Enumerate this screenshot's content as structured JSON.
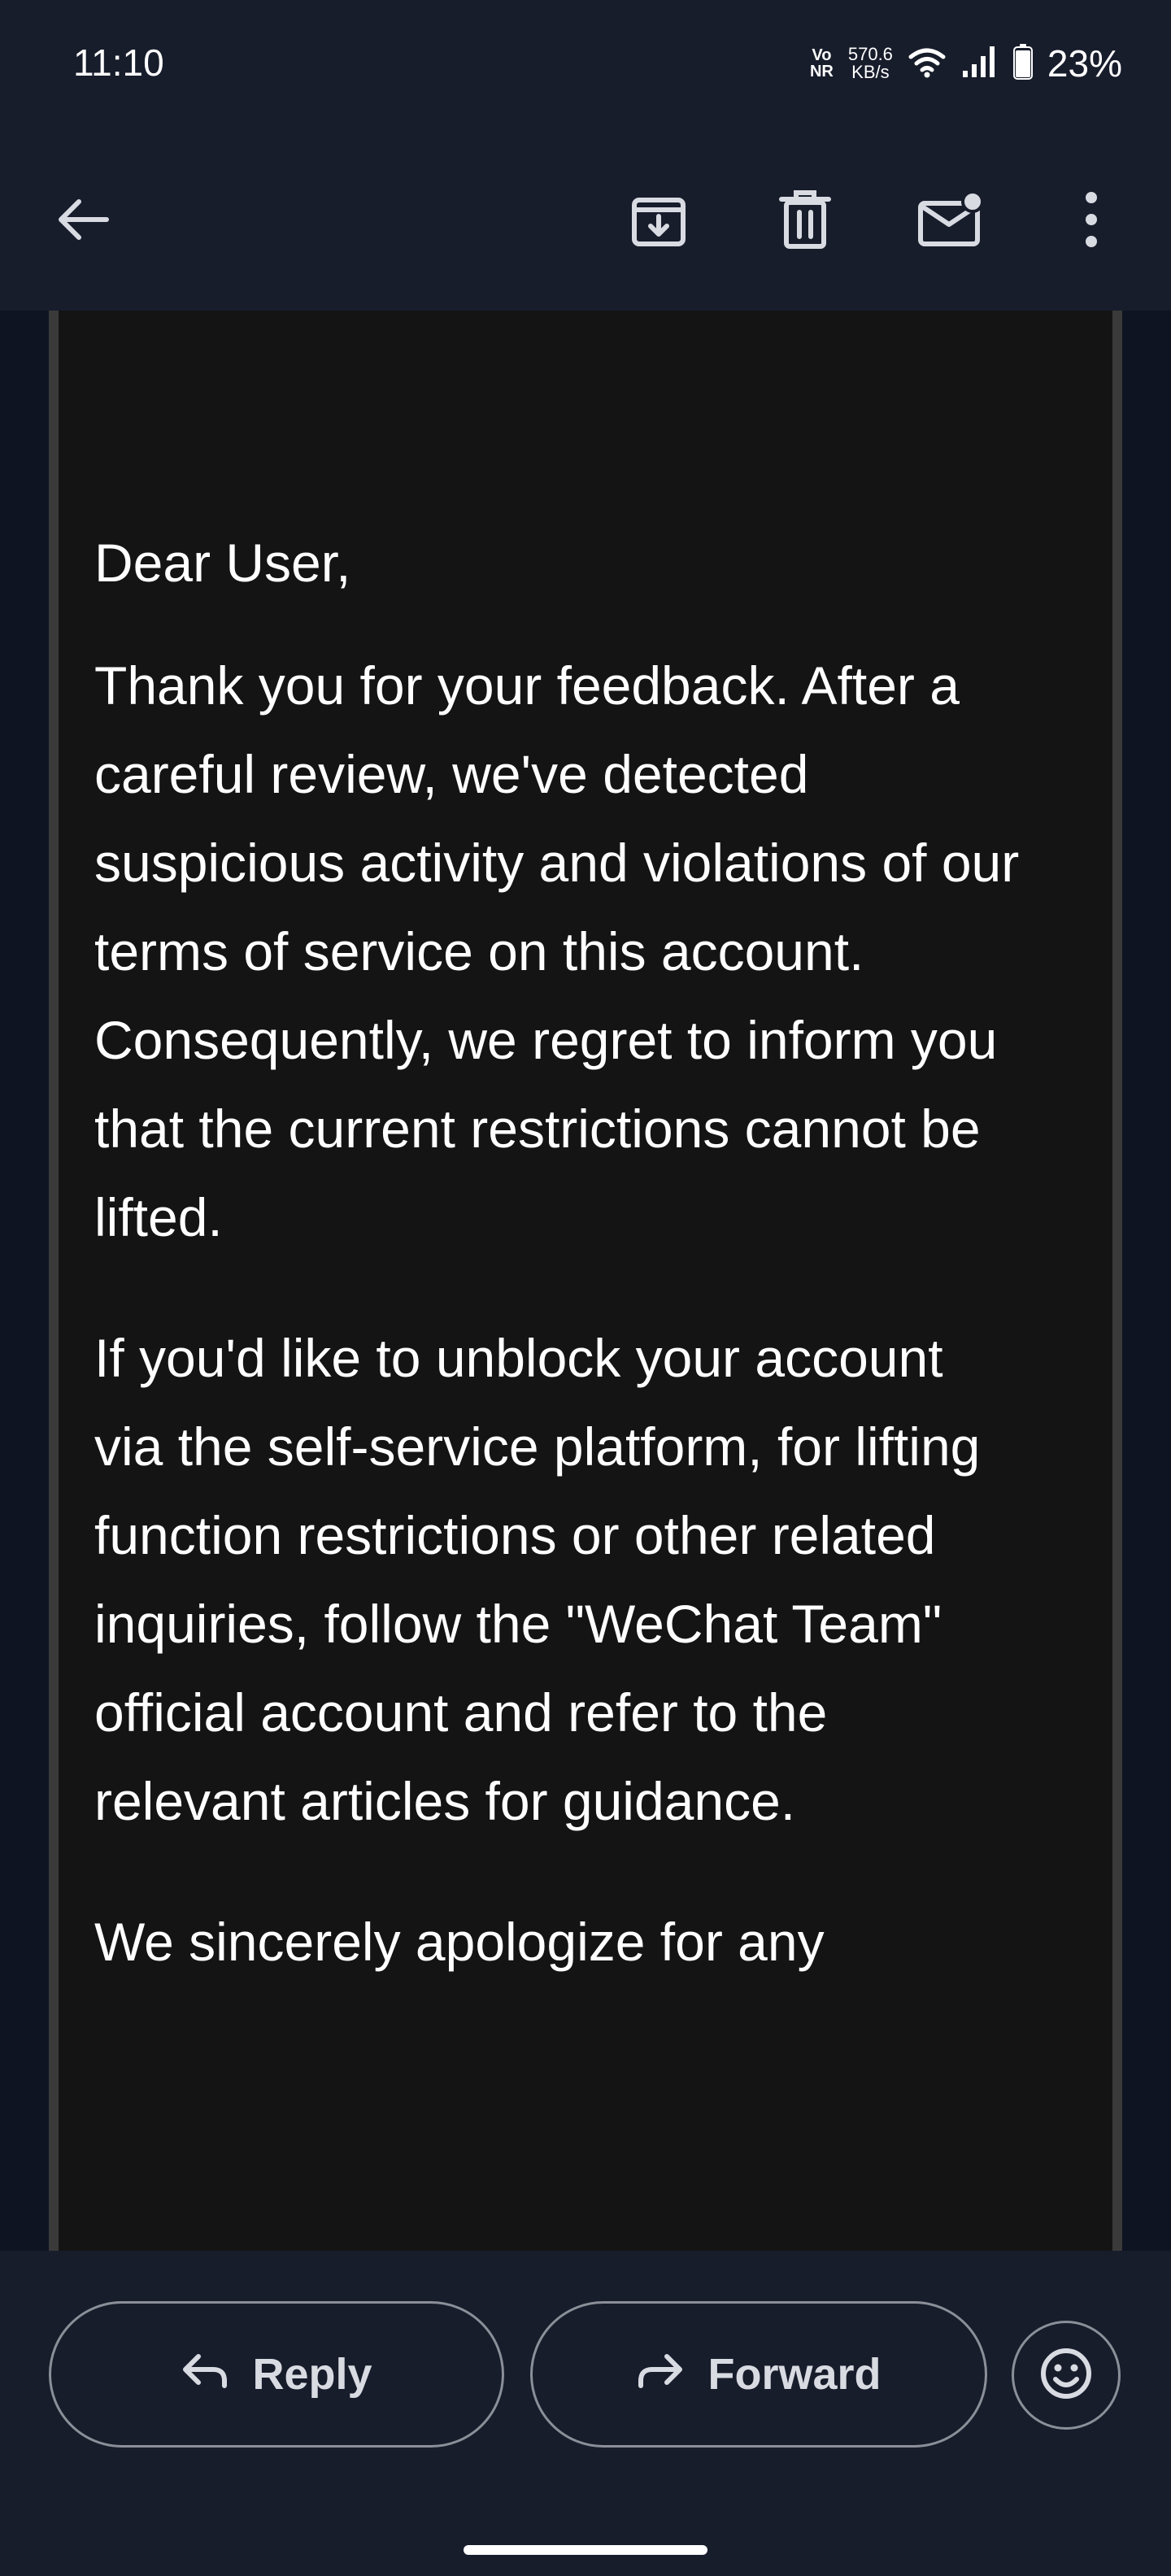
{
  "status_bar": {
    "time": "11:10",
    "volte_top": "Vo",
    "volte_bottom": "NR",
    "net_speed_value": "570.6",
    "net_speed_unit": "KB/s",
    "battery_percent": "23%",
    "icons": [
      "wifi-icon",
      "signal-icon",
      "battery-icon"
    ]
  },
  "toolbar": {
    "icons": [
      "back-arrow-icon",
      "archive-icon",
      "delete-icon",
      "mark-unread-icon",
      "more-options-icon"
    ]
  },
  "email": {
    "paragraphs": [
      "Dear User,",
      "Thank you for your feedback. After a careful review, we've detected suspicious activity and violations of our terms of service on this account. Consequently, we regret to inform you that the current restrictions cannot be lifted.",
      "If you'd like to unblock your account via the self-service platform, for lifting function restrictions or other related inquiries, follow the \"WeChat Team\" official account and refer to the relevant articles for guidance.",
      "We sincerely apologize for any"
    ]
  },
  "actions": {
    "reply_label": "Reply",
    "forward_label": "Forward",
    "emoji_icon": "emoji-reaction-icon"
  },
  "colors": {
    "chrome_background": "#181d2c",
    "mail_background": "#141414",
    "text": "#ffffff",
    "outline": "#8b8f98"
  }
}
